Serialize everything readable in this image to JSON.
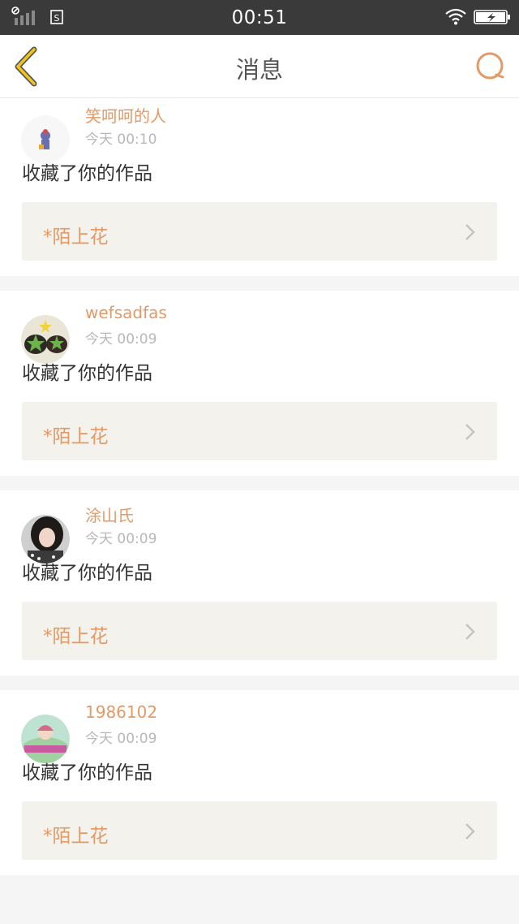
{
  "status_bar": {
    "time": "00:51"
  },
  "header": {
    "title": "消息"
  },
  "colors": {
    "accent": "#e39a66",
    "back_icon": "#f0c419",
    "status_bg": "#3a3a3a",
    "work_box_bg": "#f3f2ec"
  },
  "icons": {
    "back": "chevron-left-icon",
    "search": "search-icon",
    "chevron": "chevron-right-icon",
    "signal": "signal-icon",
    "sim": "sim-icon",
    "wifi": "wifi-icon",
    "battery": "battery-icon"
  },
  "messages": [
    {
      "username": "笑呵呵的人",
      "time": "今天 00:10",
      "action": "收藏了你的作品",
      "work_title": "*陌上花"
    },
    {
      "username": "wefsadfas",
      "time": "今天 00:09",
      "action": "收藏了你的作品",
      "work_title": "*陌上花"
    },
    {
      "username": "涂山氏",
      "time": "今天 00:09",
      "action": "收藏了你的作品",
      "work_title": "*陌上花"
    },
    {
      "username": "1986102",
      "time": "今天 00:09",
      "action": "收藏了你的作品",
      "work_title": "*陌上花"
    }
  ]
}
